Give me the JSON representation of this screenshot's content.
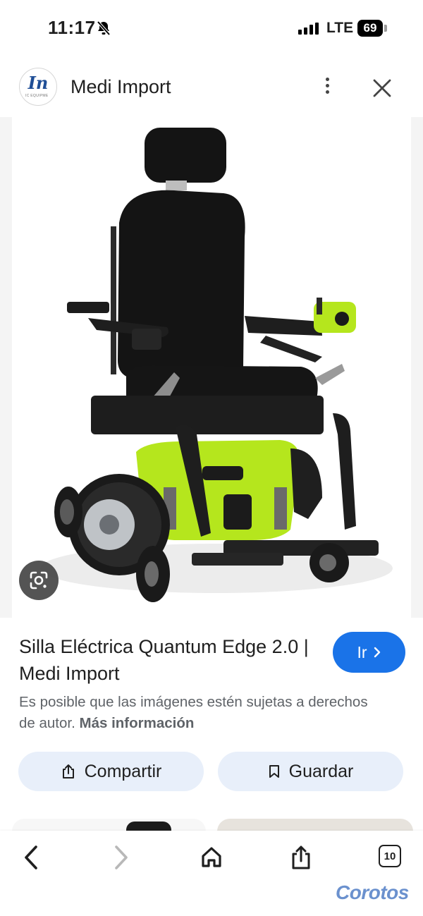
{
  "status": {
    "time": "11:17",
    "network": "LTE",
    "battery": "69"
  },
  "header": {
    "site_name": "Medi Import",
    "logo_text": "In",
    "logo_sub": "IC EQUIPME",
    "logo_icon": "medi-import-logo",
    "more_icon": "more-vert-icon",
    "close_icon": "close-icon"
  },
  "result": {
    "title": "Silla Eléctrica Quantum Edge 2.0 | Medi Import",
    "go_label": "Ir",
    "notice": "Es posible que las imágenes estén sujetas a derechos de autor.",
    "more_info": "Más información",
    "share_label": "Compartir",
    "save_label": "Guardar"
  },
  "bottom_bar": {
    "tabs_count": "10",
    "watermark": "Corotos"
  },
  "colors": {
    "accent": "#1a73e8",
    "pill_bg": "#e8effa",
    "chair_green": "#b5e61d"
  }
}
